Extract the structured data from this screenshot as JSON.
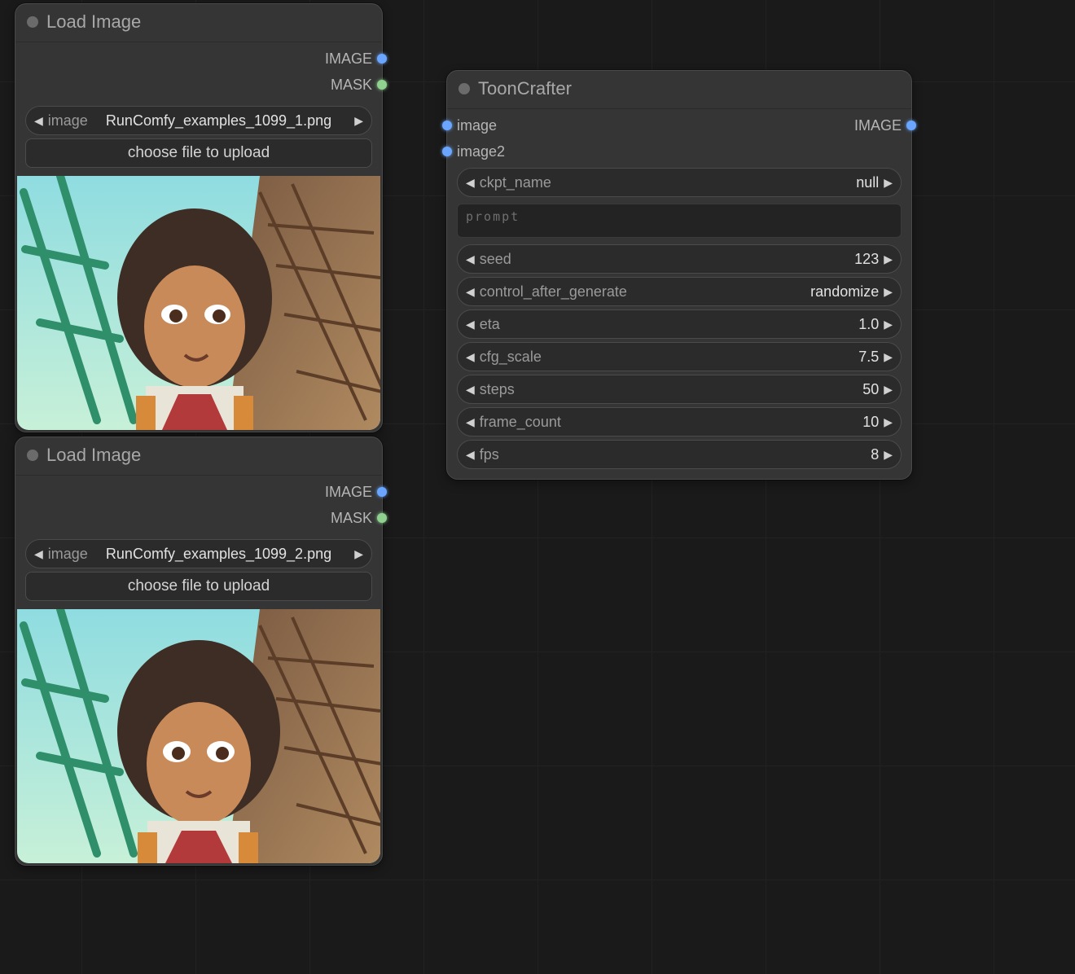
{
  "node_load1": {
    "title": "Load Image",
    "out_image": "IMAGE",
    "out_mask": "MASK",
    "image_label": "image",
    "image_value": "RunComfy_examples_1099_1.png",
    "upload_label": "choose file to upload"
  },
  "node_load2": {
    "title": "Load Image",
    "out_image": "IMAGE",
    "out_mask": "MASK",
    "image_label": "image",
    "image_value": "RunComfy_examples_1099_2.png",
    "upload_label": "choose file to upload"
  },
  "node_tc": {
    "title": "ToonCrafter",
    "in_image": "image",
    "in_image2": "image2",
    "out_image": "IMAGE",
    "ckpt_label": "ckpt_name",
    "ckpt_value": "null",
    "prompt_placeholder": "prompt",
    "params": [
      {
        "label": "seed",
        "value": "123"
      },
      {
        "label": "control_after_generate",
        "value": "randomize"
      },
      {
        "label": "eta",
        "value": "1.0"
      },
      {
        "label": "cfg_scale",
        "value": "7.5"
      },
      {
        "label": "steps",
        "value": "50"
      },
      {
        "label": "frame_count",
        "value": "10"
      },
      {
        "label": "fps",
        "value": "8"
      }
    ]
  },
  "icons": {
    "left": "◀",
    "right": "▶"
  }
}
